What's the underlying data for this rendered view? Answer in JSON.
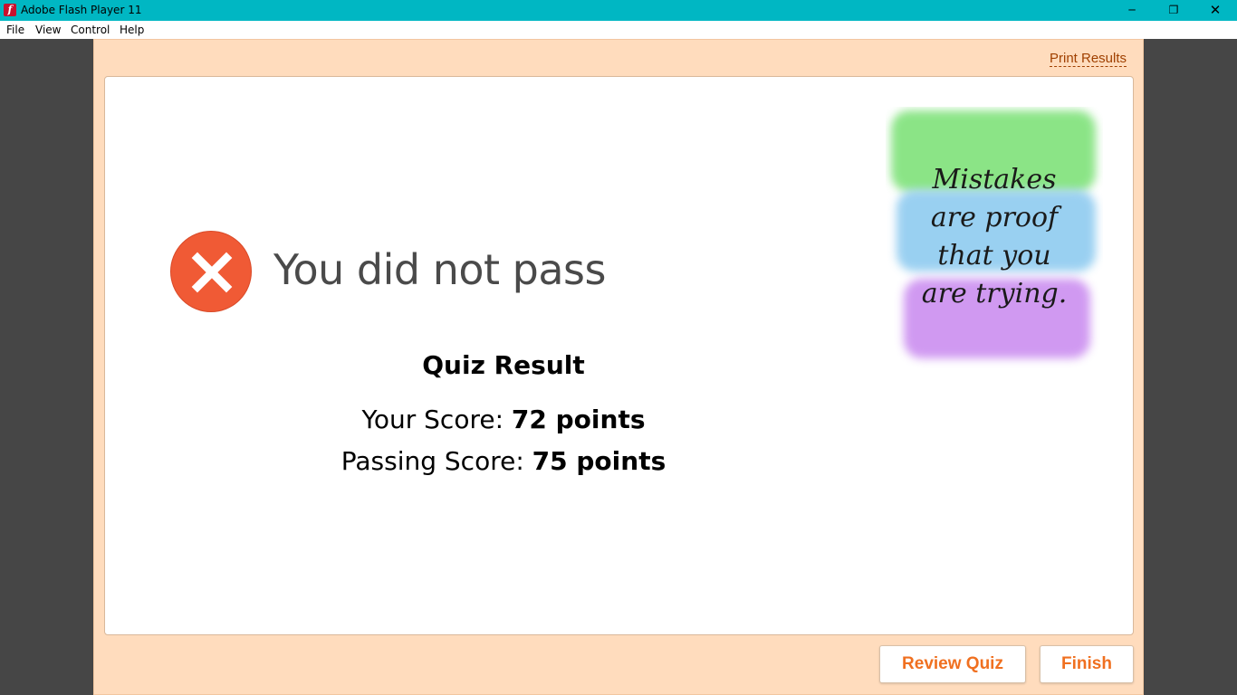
{
  "window": {
    "title": "Adobe Flash Player 11",
    "app_icon_glyph": "f",
    "controls": {
      "minimize": "─",
      "restore": "❐",
      "close": "✕"
    }
  },
  "menu": {
    "items": [
      "File",
      "View",
      "Control",
      "Help"
    ]
  },
  "result": {
    "print_label": "Print Results",
    "status_text": "You did not pass",
    "status_icon": "fail-x-icon",
    "heading": "Quiz Result",
    "your_score_label": "Your Score:",
    "your_score_value": "72 points",
    "passing_score_label": "Passing Score:",
    "passing_score_value": "75 points"
  },
  "poster": {
    "lines": [
      "Mistakes",
      "are proof",
      "that you",
      "are trying."
    ]
  },
  "buttons": {
    "review": "Review Quiz",
    "finish": "Finish"
  },
  "colors": {
    "titlebar": "#00b7c3",
    "stage_bg": "#ffdcbd",
    "fail_red": "#f05a35",
    "button_text": "#f07020",
    "link": "#a04000"
  }
}
